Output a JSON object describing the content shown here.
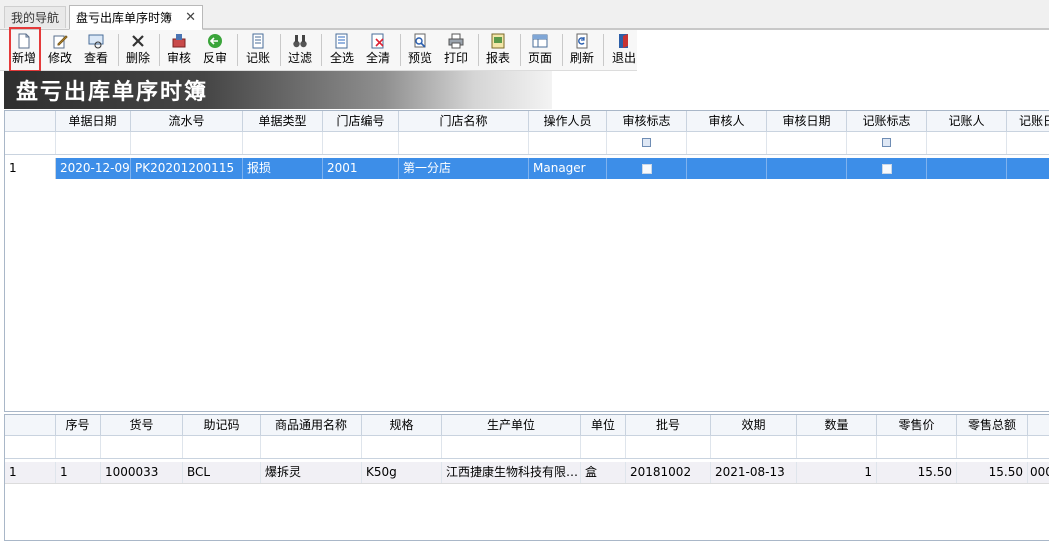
{
  "tabs": [
    {
      "label": "我的导航",
      "active": false
    },
    {
      "label": "盘亏出库单序时簿",
      "active": true
    }
  ],
  "toolbar": {
    "buttons": [
      {
        "label": "新增",
        "icon": "new-document-icon"
      },
      {
        "label": "修改",
        "icon": "edit-icon"
      },
      {
        "label": "查看",
        "icon": "view-icon"
      },
      {
        "label": "删除",
        "icon": "delete-x-icon"
      },
      {
        "label": "审核",
        "icon": "audit-icon"
      },
      {
        "label": "反审",
        "icon": "unaudit-icon"
      },
      {
        "label": "记账",
        "icon": "ledger-icon"
      },
      {
        "label": "过滤",
        "icon": "binoculars-icon"
      },
      {
        "label": "全选",
        "icon": "select-all-icon"
      },
      {
        "label": "全清",
        "icon": "clear-all-icon"
      },
      {
        "label": "预览",
        "icon": "preview-icon"
      },
      {
        "label": "打印",
        "icon": "printer-icon"
      },
      {
        "label": "报表",
        "icon": "report-icon"
      },
      {
        "label": "页面",
        "icon": "page-icon"
      },
      {
        "label": "刷新",
        "icon": "refresh-icon"
      },
      {
        "label": "退出",
        "icon": "exit-door-icon"
      }
    ]
  },
  "banner": {
    "title": "盘亏出库单序时簿"
  },
  "master_grid": {
    "columns": [
      "单据日期",
      "流水号",
      "单据类型",
      "门店编号",
      "门店名称",
      "操作人员",
      "审核标志",
      "审核人",
      "审核日期",
      "记账标志",
      "记账人",
      "记账日"
    ],
    "rows": [
      {
        "index": "1",
        "date": "2020-12-09",
        "serial": "PK20201200115",
        "type": "报损",
        "store_code": "2001",
        "store_name": "第一分店",
        "operator": "Manager",
        "audit_flag": false,
        "auditor": "",
        "audit_date": "",
        "post_flag": false,
        "poster": "",
        "post_date": ""
      }
    ]
  },
  "detail_grid": {
    "columns": [
      "序号",
      "货号",
      "助记码",
      "商品通用名称",
      "规格",
      "生产单位",
      "单位",
      "批号",
      "效期",
      "数量",
      "零售价",
      "零售总额"
    ],
    "rows": [
      {
        "index": "1",
        "seq": "1",
        "item_no": "1000033",
        "mnemonic": "BCL",
        "name": "爆拆灵",
        "spec": "K50g",
        "maker": "江西捷康生物科技有限…",
        "unit": "盒",
        "batch": "20181002",
        "expiry": "2021-08-13",
        "qty": "1",
        "price": "15.50",
        "amount": "15.50",
        "extra": "000"
      }
    ]
  },
  "colors": {
    "selected_row": "#3d8ee8",
    "highlight_box": "#e53a3a"
  }
}
